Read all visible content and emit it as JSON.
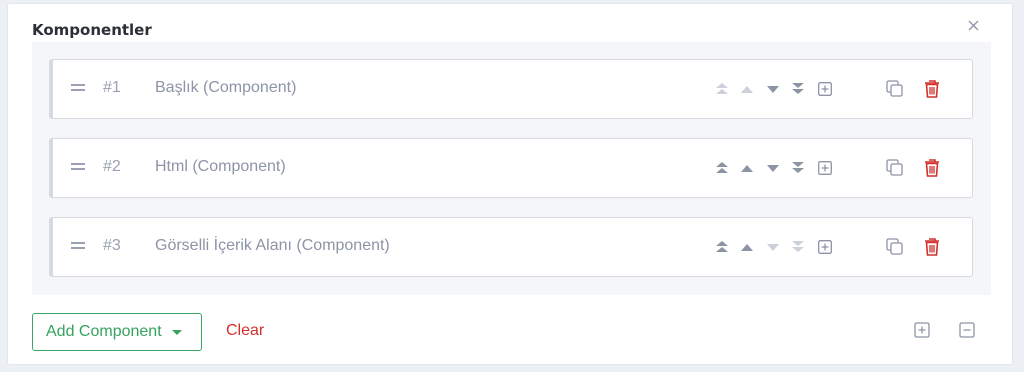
{
  "panel": {
    "title": "Komponentler",
    "close_icon": "close-icon"
  },
  "components": [
    {
      "number": "#1",
      "name": "Başlık (Component)",
      "move_top_enabled": false,
      "move_up_enabled": false,
      "move_down_enabled": true,
      "move_bottom_enabled": true
    },
    {
      "number": "#2",
      "name": "Html (Component)",
      "move_top_enabled": true,
      "move_up_enabled": true,
      "move_down_enabled": true,
      "move_bottom_enabled": true
    },
    {
      "number": "#3",
      "name": "Görselli İçerik Alanı (Component)",
      "move_top_enabled": true,
      "move_up_enabled": true,
      "move_down_enabled": false,
      "move_bottom_enabled": false
    }
  ],
  "footer": {
    "add_label": "Add Component",
    "clear_label": "Clear"
  },
  "colors": {
    "add_green": "#35a25f",
    "delete_red": "#d0312d",
    "icon_gray": "#8d94a6",
    "icon_disabled": "#ccd0d9"
  }
}
